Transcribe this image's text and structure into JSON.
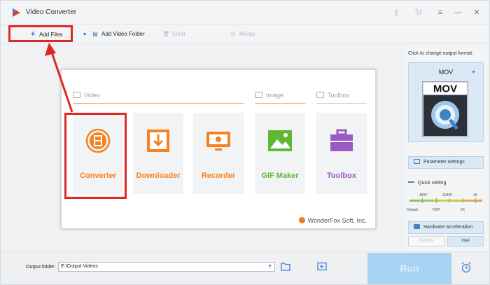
{
  "window": {
    "title": "Video Converter"
  },
  "toolbar": {
    "add_files": "Add Files",
    "add_video_folder": "Add Video Folder",
    "clear": "Clear",
    "merge": "Merge"
  },
  "sections": {
    "video": "Video",
    "image": "Image",
    "toolbox": "Toolbox"
  },
  "tiles": [
    {
      "label": "Converter",
      "color": "#f58220",
      "icon": "film-reel-icon"
    },
    {
      "label": "Downloader",
      "color": "#f58220",
      "icon": "download-icon"
    },
    {
      "label": "Recorder",
      "color": "#f58220",
      "icon": "screen-record-icon"
    },
    {
      "label": "GIF Maker",
      "color": "#5fb832",
      "icon": "picture-icon"
    },
    {
      "label": "Toolbox",
      "color": "#9b59c4",
      "icon": "briefcase-icon"
    }
  ],
  "brand": "WonderFox Soft, Inc.",
  "right_panel": {
    "hint": "Click to change output format:",
    "format": "MOV",
    "format_badge": "MOV",
    "parameter_settings": "Parameter settings",
    "quick_setting": "Quick setting",
    "ticks_top": [
      "480P",
      "1080P",
      "4K"
    ],
    "ticks_bottom": [
      "Default",
      "720P",
      "2K"
    ],
    "hardware_acceleration": "Hardware acceleration",
    "gpu_nvidia": "NVIDIA",
    "gpu_intel": "Intel"
  },
  "bottom": {
    "output_label": "Output folder:",
    "output_value": "E:\\Output Videos",
    "run": "Run"
  },
  "colors": {
    "highlight": "#e02727",
    "accent": "#4a7fc1",
    "orange": "#f58220"
  }
}
